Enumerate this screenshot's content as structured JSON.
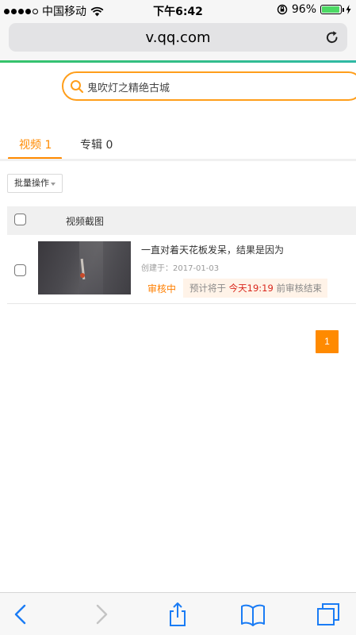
{
  "status_bar": {
    "carrier": "中国移动",
    "time": "下午6:42",
    "battery_text": "96%",
    "battery_level": 0.96
  },
  "browser": {
    "url": "v.qq.com"
  },
  "search": {
    "value": "鬼吹灯之精绝古城",
    "icon": "search-icon"
  },
  "tabs": [
    {
      "label": "视频 1",
      "active": true
    },
    {
      "label": "专辑 0",
      "active": false
    }
  ],
  "toolbar": {
    "batch_label": "批量操作"
  },
  "table": {
    "header_label": "视频截图",
    "rows": [
      {
        "title": "一直对着天花板发呆，结果是因为",
        "created": "创建于：2017-01-03",
        "status": "审核中",
        "notice_prefix": "预计将于",
        "notice_time": "今天19:19",
        "notice_suffix": "前审核结束"
      }
    ]
  },
  "pagination": {
    "current_page": "1"
  },
  "colors": {
    "accent": "#ff8a00",
    "highlight_red": "#d9271d",
    "brand_green": "#36c36a",
    "battery_green": "#4cd964"
  }
}
